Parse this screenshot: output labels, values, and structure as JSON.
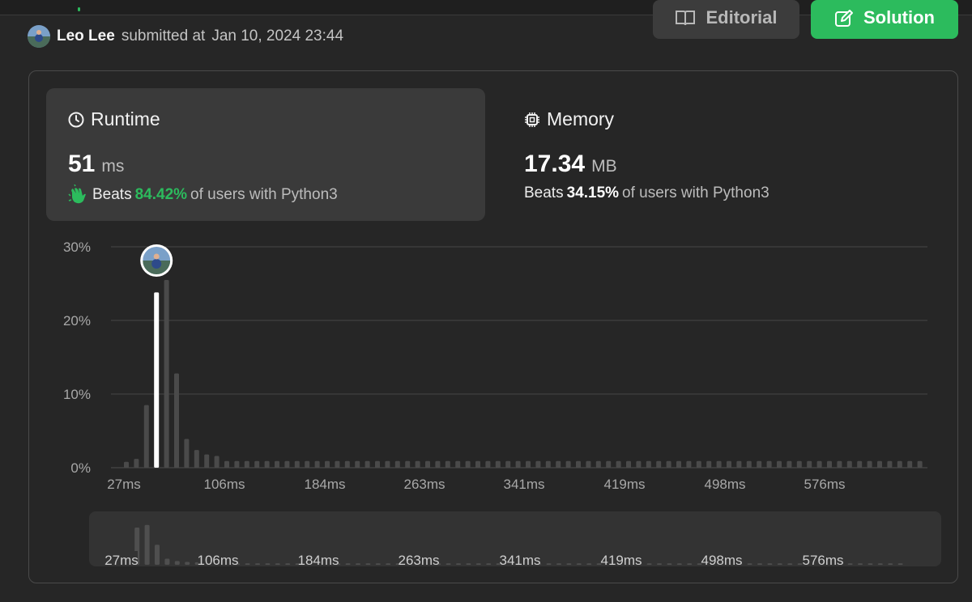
{
  "header": {
    "user_name": "Leo Lee",
    "submitted_label": "submitted at",
    "submitted_time": "Jan 10, 2024 23:44"
  },
  "toolbar": {
    "editorial_label": "Editorial",
    "editorial_icon": "book-open-icon",
    "solution_label": "Solution",
    "solution_icon": "edit-square-icon",
    "solution_color": "#2cbb5d"
  },
  "runtime": {
    "title": "Runtime",
    "icon": "clock-icon",
    "value": "51",
    "unit": "ms",
    "beats_label": "Beats",
    "beats_pct": "84.42%",
    "beats_suffix": "of users with Python3",
    "beats_icon": "clapping-hands-icon",
    "beats_color": "#2cbb5d"
  },
  "memory": {
    "title": "Memory",
    "icon": "chip-icon",
    "value": "17.34",
    "unit": "MB",
    "beats_label": "Beats",
    "beats_pct": "34.15%",
    "beats_suffix": "of users with Python3"
  },
  "chart_data": {
    "type": "bar",
    "ylim": [
      0,
      30
    ],
    "yticks": [
      "0%",
      "10%",
      "20%",
      "30%"
    ],
    "xticks": [
      "27ms",
      "106ms",
      "184ms",
      "263ms",
      "341ms",
      "419ms",
      "498ms",
      "576ms"
    ],
    "highlight_index": 3,
    "values": [
      0.8,
      1.2,
      8.5,
      23.8,
      25.5,
      12.8,
      3.9,
      2.4,
      1.8,
      1.6,
      0.9,
      0.9,
      0.9,
      0.9,
      0.9,
      0.9,
      0.9,
      0.9,
      0.9,
      0.9,
      0.9,
      0.9,
      0.9,
      0.9,
      0.9,
      0.9,
      0.9,
      0.9,
      0.9,
      0.9,
      0.9,
      0.9,
      0.9,
      0.9,
      0.9,
      0.9,
      0.9,
      0.9,
      0.9,
      0.9,
      0.9,
      0.9,
      0.9,
      0.9,
      0.9,
      0.9,
      0.9,
      0.9,
      0.9,
      0.9,
      0.9,
      0.9,
      0.9,
      0.9,
      0.9,
      0.9,
      0.9,
      0.9,
      0.9,
      0.9,
      0.9,
      0.9,
      0.9,
      0.9,
      0.9,
      0.9,
      0.9,
      0.9,
      0.9,
      0.9,
      0.9,
      0.9,
      0.9,
      0.9,
      0.9,
      0.9,
      0.9,
      0.9,
      0.9,
      0.9
    ],
    "grid": true,
    "bar_color": "#4a4a4a",
    "highlight_color": "#ffffff",
    "minimap_xticks": [
      "27ms",
      "106ms",
      "184ms",
      "263ms",
      "341ms",
      "419ms",
      "498ms",
      "576ms"
    ]
  }
}
